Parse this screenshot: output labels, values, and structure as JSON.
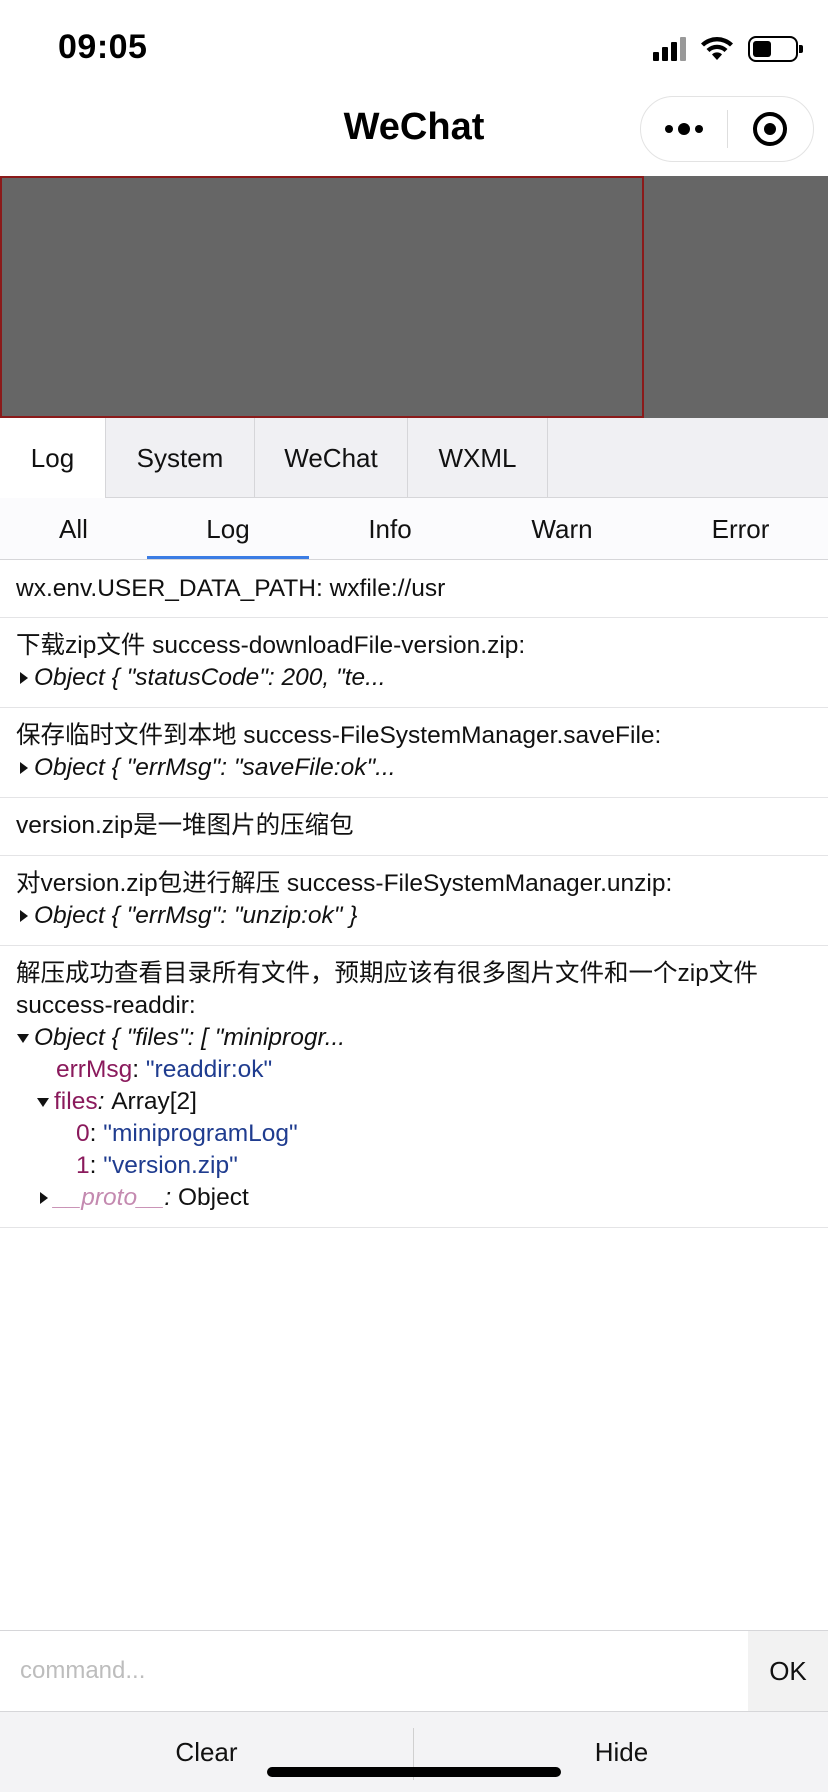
{
  "status_bar": {
    "time": "09:05"
  },
  "nav": {
    "title": "WeChat"
  },
  "main_tabs": [
    {
      "label": "Log"
    },
    {
      "label": "System"
    },
    {
      "label": "WeChat"
    },
    {
      "label": "WXML"
    }
  ],
  "filter_tabs": [
    {
      "label": "All"
    },
    {
      "label": "Log"
    },
    {
      "label": "Info"
    },
    {
      "label": "Warn"
    },
    {
      "label": "Error"
    }
  ],
  "logs": {
    "entry1": {
      "text": "wx.env.USER_DATA_PATH: wxfile://usr"
    },
    "entry2": {
      "text": "下载zip文件 success-downloadFile-version.zip:",
      "object": "Object { \"statusCode\": 200, \"te..."
    },
    "entry3": {
      "text": "保存临时文件到本地 success-FileSystemManager.saveFile:",
      "object": "Object { \"errMsg\": \"saveFile:ok\"..."
    },
    "entry4": {
      "text": "version.zip是一堆图片的压缩包"
    },
    "entry5": {
      "text": "对version.zip包进行解压 success-FileSystemManager.unzip:",
      "object": "Object { \"errMsg\": \"unzip:ok\" }"
    },
    "entry6": {
      "text_line1": "解压成功查看目录所有文件，预期应该有很多图片文件和一个zip文件",
      "text_line2": "success-readdir:",
      "object": "Object { \"files\": [ \"miniprogr...",
      "errmsg_key": "errMsg",
      "errmsg_value": "\"readdir:ok\"",
      "files_key": "files",
      "files_type": "Array[2]",
      "file0_index": "0",
      "file0_value": "\"miniprogramLog\"",
      "file1_index": "1",
      "file1_value": "\"version.zip\"",
      "proto_key": "__proto__",
      "proto_type": "Object"
    }
  },
  "command": {
    "placeholder": "command...",
    "ok_label": "OK"
  },
  "bottom": {
    "clear_label": "Clear",
    "hide_label": "Hide"
  },
  "colors": {
    "accent": "#3b7ce4",
    "highlight_border": "#8b1a1a",
    "key": "#8a1a5c",
    "string": "#1f3c8f"
  }
}
